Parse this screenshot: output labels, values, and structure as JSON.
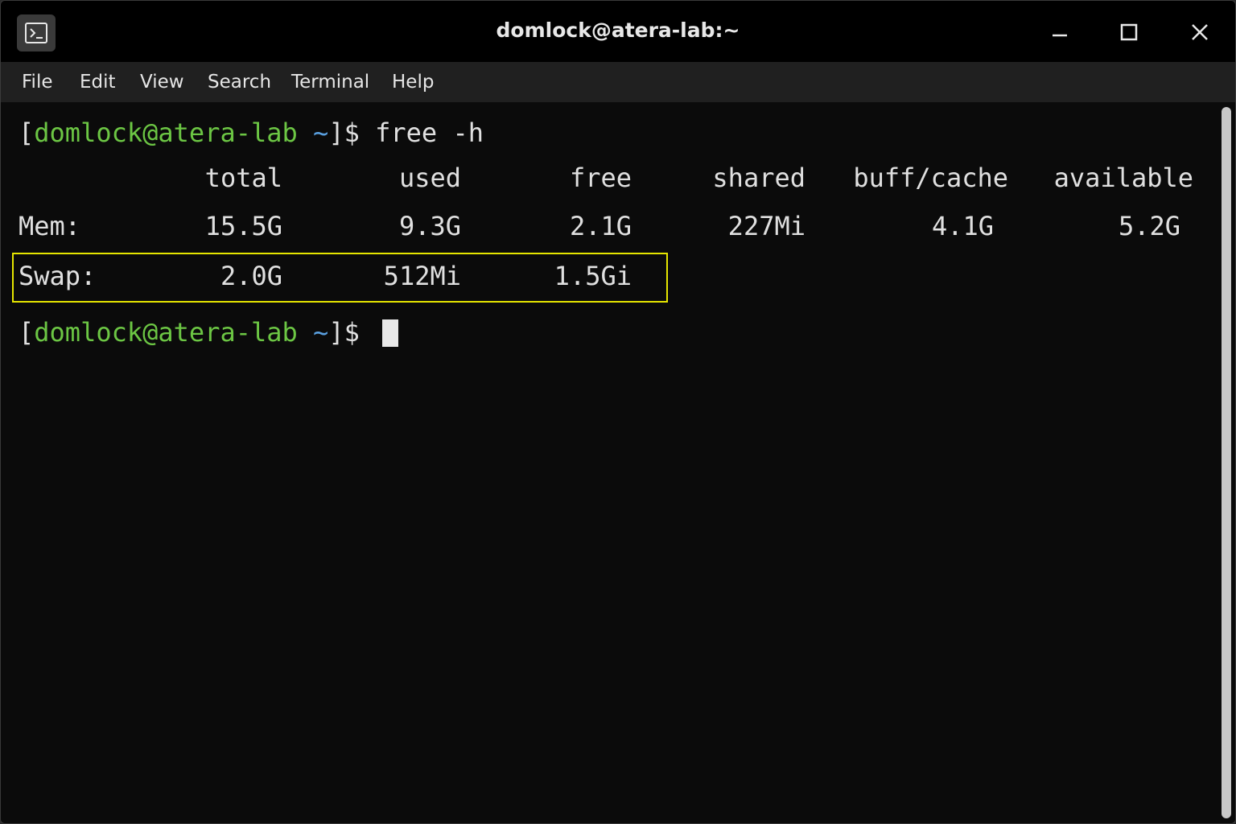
{
  "window": {
    "title": "domlock@atera-lab:~",
    "icons": {
      "app": "terminal-icon",
      "minimize": "minimize-icon",
      "maximize": "maximize-icon",
      "close": "close-icon"
    }
  },
  "menubar": {
    "items": [
      "File",
      "Edit",
      "View",
      "Search",
      "Terminal",
      "Help"
    ]
  },
  "terminal": {
    "prompt": {
      "open_bracket": "[",
      "user_host": "domlock@atera-lab",
      "cwd": "~",
      "close": "]$"
    },
    "command": "free -h",
    "headers": [
      "total",
      "used",
      "free",
      "shared",
      "buff/cache",
      "available"
    ],
    "rows": [
      {
        "label": "Mem:",
        "values": [
          "15.5G",
          "9.3G",
          "2.1G",
          "227Mi",
          "4.1G",
          "5.2G"
        ]
      },
      {
        "label": "Swap:",
        "values": [
          "2.0G",
          "512Mi",
          "1.5Gi"
        ]
      }
    ],
    "highlight_color": "#e6e600",
    "prompt_color": "#6cc644",
    "cwd_color": "#5aa0e0"
  }
}
